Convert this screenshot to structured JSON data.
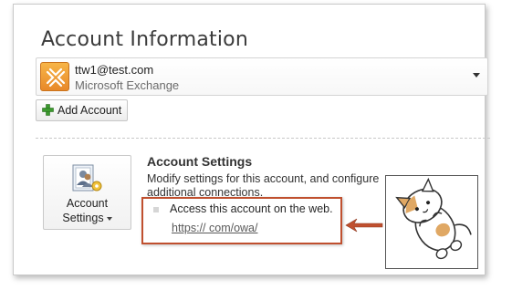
{
  "page": {
    "title": "Account Information"
  },
  "account": {
    "email": "ttw1@test.com",
    "type": "Microsoft Exchange",
    "icon": "exchange-icon"
  },
  "buttons": {
    "add_account": "Add Account",
    "account_settings_line1": "Account",
    "account_settings_line2": "Settings"
  },
  "account_settings": {
    "heading": "Account Settings",
    "description": "Modify settings for this account, and configure additional connections.",
    "access_text": "Access this account on the web.",
    "owa_link": "https://            com/owa/"
  },
  "colors": {
    "highlight": "#c0502f",
    "arrow": "#c0502f",
    "exchange_orange": "#e8892a",
    "add_green": "#3c9a2f"
  }
}
